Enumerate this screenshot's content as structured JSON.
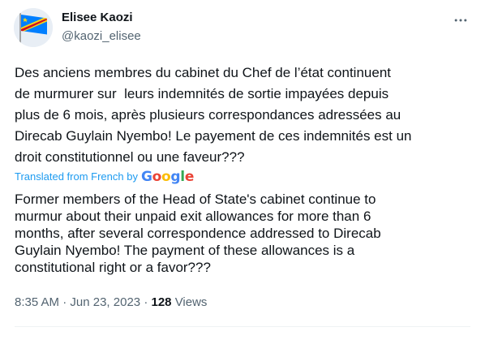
{
  "author": {
    "display_name": "Elisee Kaozi",
    "handle": "@kaozi_elisee"
  },
  "tweet": {
    "text": "Des anciens membres du cabinet du Chef de l’état continuent\nde murmurer sur  leurs indemnités de sortie impayées depuis\nplus de 6 mois, après plusieurs correspondances adressées au\nDirecab Guylain Nyembo! Le payement de ces indemnités est un\ndroit constitutionnel ou une faveur???",
    "translated_label": "Translated from French by",
    "translation_provider": "Google",
    "translation": "Former members of the Head of State's cabinet continue to\nmurmur about their unpaid exit allowances for more than 6\nmonths, after several correspondence addressed to Direcab\nGuylain Nyembo! The payment of these allowances is a\nconstitutional right or a favor???"
  },
  "meta": {
    "time": "8:35 AM",
    "separator": "·",
    "date": "Jun 23, 2023",
    "views_count": "128",
    "views_label": "Views"
  },
  "icons": {
    "avatar": "drc-flag-avatar",
    "more": "more-horizontal-icon"
  },
  "colors": {
    "accent": "#1d9bf0",
    "secondary_text": "#536471",
    "primary_text": "#0f1419"
  }
}
